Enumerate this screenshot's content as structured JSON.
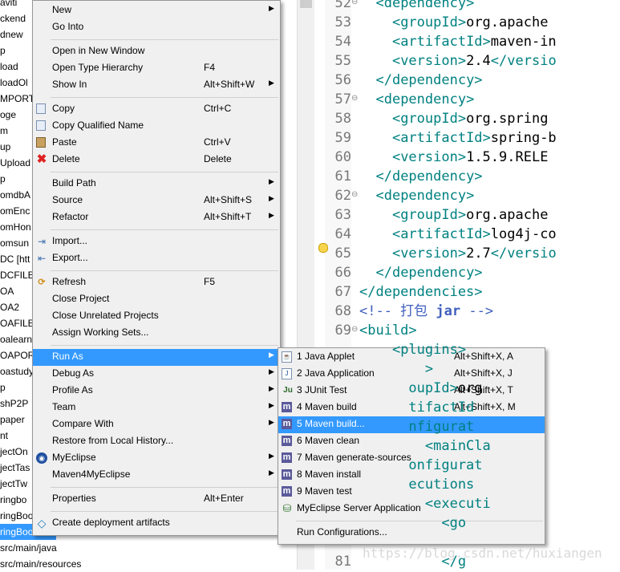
{
  "explorer": {
    "items": [
      "aviti",
      "ckend",
      "dnew",
      "p",
      "load",
      "loadOl",
      "MPORT",
      "oge",
      "m",
      "up",
      "Upload",
      "p",
      "omdbA",
      "omEnc",
      "omHon",
      "omsun",
      "DC [htt",
      "DCFILE",
      "OA",
      "OA2",
      "OAFILE",
      "oalearn",
      "OAPOR",
      "oastudy",
      "p",
      "shP2P",
      "paper",
      "nt",
      "jectOn",
      "jectTas",
      "jectTw",
      "ringbo",
      "ringBoo",
      "ringBoo",
      "src/main/java",
      "src/main/resources"
    ]
  },
  "editor": {
    "lines": [
      {
        "n": "52",
        "indent": "  ",
        "parts": [
          {
            "c": "tag",
            "t": "<dependency>"
          }
        ]
      },
      {
        "n": "53",
        "indent": "    ",
        "parts": [
          {
            "c": "tag",
            "t": "<groupId>"
          },
          {
            "c": "txt",
            "t": "org.apache"
          }
        ]
      },
      {
        "n": "54",
        "indent": "    ",
        "parts": [
          {
            "c": "tag",
            "t": "<artifactId>"
          },
          {
            "c": "txt",
            "t": "maven-in"
          }
        ]
      },
      {
        "n": "55",
        "indent": "    ",
        "parts": [
          {
            "c": "tag",
            "t": "<version>"
          },
          {
            "c": "txt",
            "t": "2.4"
          },
          {
            "c": "tag",
            "t": "</versio"
          }
        ]
      },
      {
        "n": "56",
        "indent": "  ",
        "parts": [
          {
            "c": "tag",
            "t": "</dependency>"
          }
        ]
      },
      {
        "n": "57",
        "indent": "  ",
        "parts": [
          {
            "c": "tag",
            "t": "<dependency>"
          }
        ]
      },
      {
        "n": "58",
        "indent": "    ",
        "parts": [
          {
            "c": "tag",
            "t": "<groupId>"
          },
          {
            "c": "txt",
            "t": "org.spring"
          }
        ]
      },
      {
        "n": "59",
        "indent": "    ",
        "parts": [
          {
            "c": "tag",
            "t": "<artifactId>"
          },
          {
            "c": "txt",
            "t": "spring-b"
          }
        ]
      },
      {
        "n": "60",
        "indent": "    ",
        "parts": [
          {
            "c": "tag",
            "t": "<version>"
          },
          {
            "c": "txt",
            "t": "1.5.9.RELE"
          }
        ]
      },
      {
        "n": "61",
        "indent": "  ",
        "parts": [
          {
            "c": "tag",
            "t": "</dependency>"
          }
        ]
      },
      {
        "n": "62",
        "indent": "  ",
        "parts": [
          {
            "c": "tag",
            "t": "<dependency>"
          }
        ]
      },
      {
        "n": "63",
        "indent": "    ",
        "parts": [
          {
            "c": "tag",
            "t": "<groupId>"
          },
          {
            "c": "txt",
            "t": "org.apache"
          }
        ]
      },
      {
        "n": "64",
        "indent": "    ",
        "parts": [
          {
            "c": "tag",
            "t": "<artifactId>"
          },
          {
            "c": "txt",
            "t": "log4j-co"
          }
        ]
      },
      {
        "n": "65",
        "indent": "    ",
        "parts": [
          {
            "c": "tag",
            "t": "<version>"
          },
          {
            "c": "txt",
            "t": "2.7"
          },
          {
            "c": "tag",
            "t": "</versio"
          }
        ]
      },
      {
        "n": "66",
        "indent": "  ",
        "parts": [
          {
            "c": "tag",
            "t": "</dependency>"
          }
        ]
      },
      {
        "n": "67",
        "indent": "",
        "parts": [
          {
            "c": "tag",
            "t": "</dependencies>"
          }
        ]
      },
      {
        "n": "68",
        "indent": "",
        "parts": [
          {
            "c": "cmt",
            "t": "<!-- 打包 "
          },
          {
            "c": "cmtkw",
            "t": "jar"
          },
          {
            "c": "cmt",
            "t": " -->"
          }
        ]
      },
      {
        "n": "69",
        "indent": "",
        "parts": [
          {
            "c": "tag",
            "t": "<build>"
          }
        ]
      },
      {
        "n": "",
        "indent": "    ",
        "parts": [
          {
            "c": "tag",
            "t": "<plugins>"
          }
        ]
      },
      {
        "n": "",
        "indent": "      ",
        "parts": [
          {
            "c": "tag",
            "t": "  >"
          }
        ]
      },
      {
        "n": "",
        "indent": "",
        "parts": [
          {
            "c": "tag",
            "t": "      oupId>"
          },
          {
            "c": "txt",
            "t": "org"
          }
        ]
      },
      {
        "n": "",
        "indent": "",
        "parts": [
          {
            "c": "tag",
            "t": "      tifactId"
          }
        ]
      },
      {
        "n": "",
        "indent": "",
        "parts": [
          {
            "c": "tag",
            "t": "      nfigurat"
          }
        ]
      },
      {
        "n": "",
        "indent": "",
        "parts": [
          {
            "c": "tag",
            "t": "        <mainCla"
          }
        ]
      },
      {
        "n": "",
        "indent": "",
        "parts": [
          {
            "c": "tag",
            "t": "      onfigurat"
          }
        ]
      },
      {
        "n": "",
        "indent": "",
        "parts": [
          {
            "c": "tag",
            "t": "      ecutions"
          }
        ]
      },
      {
        "n": "",
        "indent": "",
        "parts": [
          {
            "c": "tag",
            "t": "        <executi"
          }
        ]
      },
      {
        "n": "",
        "indent": "",
        "parts": [
          {
            "c": "tag",
            "t": "          <go"
          }
        ]
      },
      {
        "n": "",
        "indent": "",
        "parts": []
      },
      {
        "n": "81",
        "indent": "",
        "parts": [
          {
            "c": "tag",
            "t": "          </g"
          }
        ]
      }
    ],
    "watermark": "https://blog.csdn.net/huxiangen"
  },
  "context_menu": {
    "items": [
      {
        "label": "New",
        "accel": "",
        "submenu": true,
        "icon": ""
      },
      {
        "label": "Go Into",
        "accel": "",
        "submenu": false,
        "icon": ""
      },
      {
        "sep": true
      },
      {
        "label": "Open in New Window",
        "accel": "",
        "submenu": false,
        "icon": ""
      },
      {
        "label": "Open Type Hierarchy",
        "accel": "F4",
        "submenu": false,
        "icon": ""
      },
      {
        "label": "Show In",
        "accel": "Alt+Shift+W",
        "submenu": true,
        "icon": ""
      },
      {
        "sep": true
      },
      {
        "label": "Copy",
        "accel": "Ctrl+C",
        "submenu": false,
        "icon": "copy-icon"
      },
      {
        "label": "Copy Qualified Name",
        "accel": "",
        "submenu": false,
        "icon": "copy-qualified-icon"
      },
      {
        "label": "Paste",
        "accel": "Ctrl+V",
        "submenu": false,
        "icon": "paste-icon"
      },
      {
        "label": "Delete",
        "accel": "Delete",
        "submenu": false,
        "icon": "delete-icon"
      },
      {
        "sep": true
      },
      {
        "label": "Build Path",
        "accel": "",
        "submenu": true,
        "icon": ""
      },
      {
        "label": "Source",
        "accel": "Alt+Shift+S",
        "submenu": true,
        "icon": ""
      },
      {
        "label": "Refactor",
        "accel": "Alt+Shift+T",
        "submenu": true,
        "icon": ""
      },
      {
        "sep": true
      },
      {
        "label": "Import...",
        "accel": "",
        "submenu": false,
        "icon": "import-icon"
      },
      {
        "label": "Export...",
        "accel": "",
        "submenu": false,
        "icon": "export-icon"
      },
      {
        "sep": true
      },
      {
        "label": "Refresh",
        "accel": "F5",
        "submenu": false,
        "icon": "refresh-icon"
      },
      {
        "label": "Close Project",
        "accel": "",
        "submenu": false,
        "icon": ""
      },
      {
        "label": "Close Unrelated Projects",
        "accel": "",
        "submenu": false,
        "icon": ""
      },
      {
        "label": "Assign Working Sets...",
        "accel": "",
        "submenu": false,
        "icon": ""
      },
      {
        "sep": true
      },
      {
        "label": "Run As",
        "accel": "",
        "submenu": true,
        "icon": "",
        "highlight": true
      },
      {
        "label": "Debug As",
        "accel": "",
        "submenu": true,
        "icon": ""
      },
      {
        "label": "Profile As",
        "accel": "",
        "submenu": true,
        "icon": ""
      },
      {
        "label": "Team",
        "accel": "",
        "submenu": true,
        "icon": ""
      },
      {
        "label": "Compare With",
        "accel": "",
        "submenu": true,
        "icon": ""
      },
      {
        "label": "Restore from Local History...",
        "accel": "",
        "submenu": false,
        "icon": ""
      },
      {
        "label": "MyEclipse",
        "accel": "",
        "submenu": true,
        "icon": "myeclipse-icon"
      },
      {
        "label": "Maven4MyEclipse",
        "accel": "",
        "submenu": true,
        "icon": ""
      },
      {
        "sep": true
      },
      {
        "label": "Properties",
        "accel": "Alt+Enter",
        "submenu": false,
        "icon": ""
      },
      {
        "sep": true
      },
      {
        "label": "Create deployment artifacts",
        "accel": "",
        "submenu": false,
        "icon": "deploy-icon"
      }
    ]
  },
  "run_as_menu": {
    "items": [
      {
        "label": "1 Java Applet",
        "accel": "Alt+Shift+X, A",
        "icon": "java-applet-icon"
      },
      {
        "label": "2 Java Application",
        "accel": "Alt+Shift+X, J",
        "icon": "java-application-icon"
      },
      {
        "label": "3 JUnit Test",
        "accel": "Alt+Shift+X, T",
        "icon": "junit-icon"
      },
      {
        "label": "4 Maven build",
        "accel": "Alt+Shift+X, M",
        "icon": "maven-icon"
      },
      {
        "label": "5 Maven build...",
        "accel": "",
        "icon": "maven-icon",
        "highlight": true
      },
      {
        "label": "6 Maven clean",
        "accel": "",
        "icon": "maven-icon"
      },
      {
        "label": "7 Maven generate-sources",
        "accel": "",
        "icon": "maven-icon"
      },
      {
        "label": "8 Maven install",
        "accel": "",
        "icon": "maven-icon"
      },
      {
        "label": "9 Maven test",
        "accel": "",
        "icon": "maven-icon"
      },
      {
        "label": "MyEclipse Server Application",
        "accel": "",
        "icon": "server-icon"
      },
      {
        "sep": true
      },
      {
        "label": "Run Configurations...",
        "accel": "",
        "icon": ""
      }
    ]
  },
  "icons": {
    "junit_glyph": "Ju",
    "maven_glyph": "m",
    "submenu_arrow": "▶"
  }
}
